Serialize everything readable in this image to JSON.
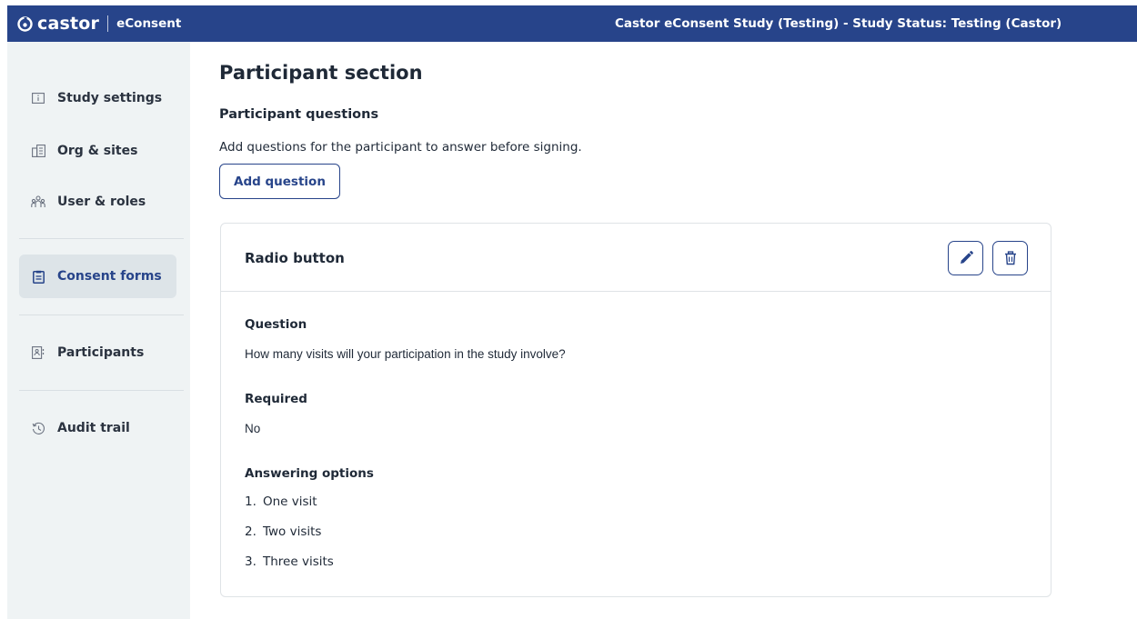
{
  "header": {
    "brand": "castor",
    "product": "eConsent",
    "study_status": "Castor eConsent Study (Testing)  - Study Status: Testing (Castor)"
  },
  "sidebar": {
    "items": [
      {
        "label": "Study settings",
        "icon": "info-icon"
      },
      {
        "label": "Org & sites",
        "icon": "building-icon"
      },
      {
        "label": "User & roles",
        "icon": "users-icon"
      },
      {
        "label": "Consent forms",
        "icon": "clipboard-icon",
        "active": true
      },
      {
        "label": "Participants",
        "icon": "participants-icon"
      },
      {
        "label": "Audit trail",
        "icon": "history-icon"
      }
    ]
  },
  "main": {
    "title": "Participant section",
    "section_title": "Participant questions",
    "section_desc": "Add questions for the participant to answer before signing.",
    "add_button": "Add question",
    "card": {
      "title": "Radio button",
      "question_label": "Question",
      "question_value": "How many visits will your participation in the study involve?",
      "required_label": "Required",
      "required_value": "No",
      "options_label": "Answering options",
      "options": [
        {
          "num": "1.",
          "text": "One visit"
        },
        {
          "num": "2.",
          "text": "Two visits"
        },
        {
          "num": "3.",
          "text": "Three visits"
        }
      ]
    }
  },
  "colors": {
    "brand": "#27448a",
    "sidebar_bg": "#eff3f4",
    "active_bg": "#dde4e8"
  }
}
